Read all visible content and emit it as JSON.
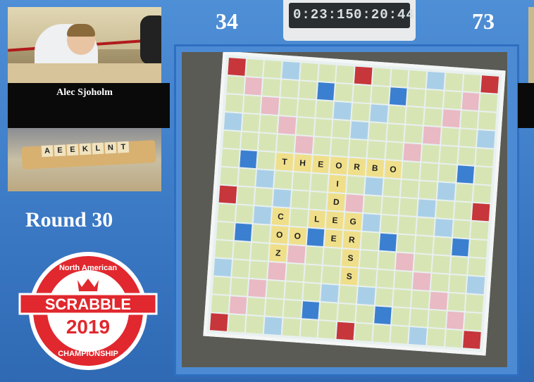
{
  "player": {
    "name": "Alec Sjoholm",
    "rack": [
      "A",
      "E",
      "E",
      "K",
      "L",
      "N",
      "T"
    ]
  },
  "scores": {
    "left": "34",
    "right": "73"
  },
  "clocks": {
    "left": "0:23:15",
    "right": "0:20:44"
  },
  "round": {
    "label": "Round 30"
  },
  "logo": {
    "top": "North American",
    "main": "SCRABBLE",
    "year": "2019",
    "bottom": "CHAMPIONSHIP"
  },
  "board": {
    "words": [
      {
        "row": 5,
        "col": 3,
        "dir": "across",
        "letters": [
          "T",
          "H",
          "E",
          "O",
          "R",
          "B",
          "O"
        ]
      },
      {
        "row": 6,
        "col": 6,
        "dir": "down",
        "letters": [
          "I",
          "D",
          "L",
          "E"
        ]
      },
      {
        "row": 8,
        "col": 5,
        "dir": "across",
        "letters": [
          "L",
          "E",
          "G"
        ]
      },
      {
        "row": 9,
        "col": 7,
        "dir": "down",
        "letters": [
          "R",
          "S"
        ]
      },
      {
        "row": 8,
        "col": 3,
        "dir": "down",
        "letters": [
          "C",
          "O",
          "Z"
        ]
      },
      {
        "row": 9,
        "col": 4,
        "dir": "across",
        "letters": [
          "O"
        ]
      },
      {
        "row": 11,
        "col": 7,
        "dir": "across",
        "letters": [
          "S"
        ]
      }
    ]
  },
  "colors": {
    "background": "#3a78c4",
    "tile": "#f0df8a",
    "triple_word": "#c6363a",
    "logo_red": "#e0282e"
  }
}
